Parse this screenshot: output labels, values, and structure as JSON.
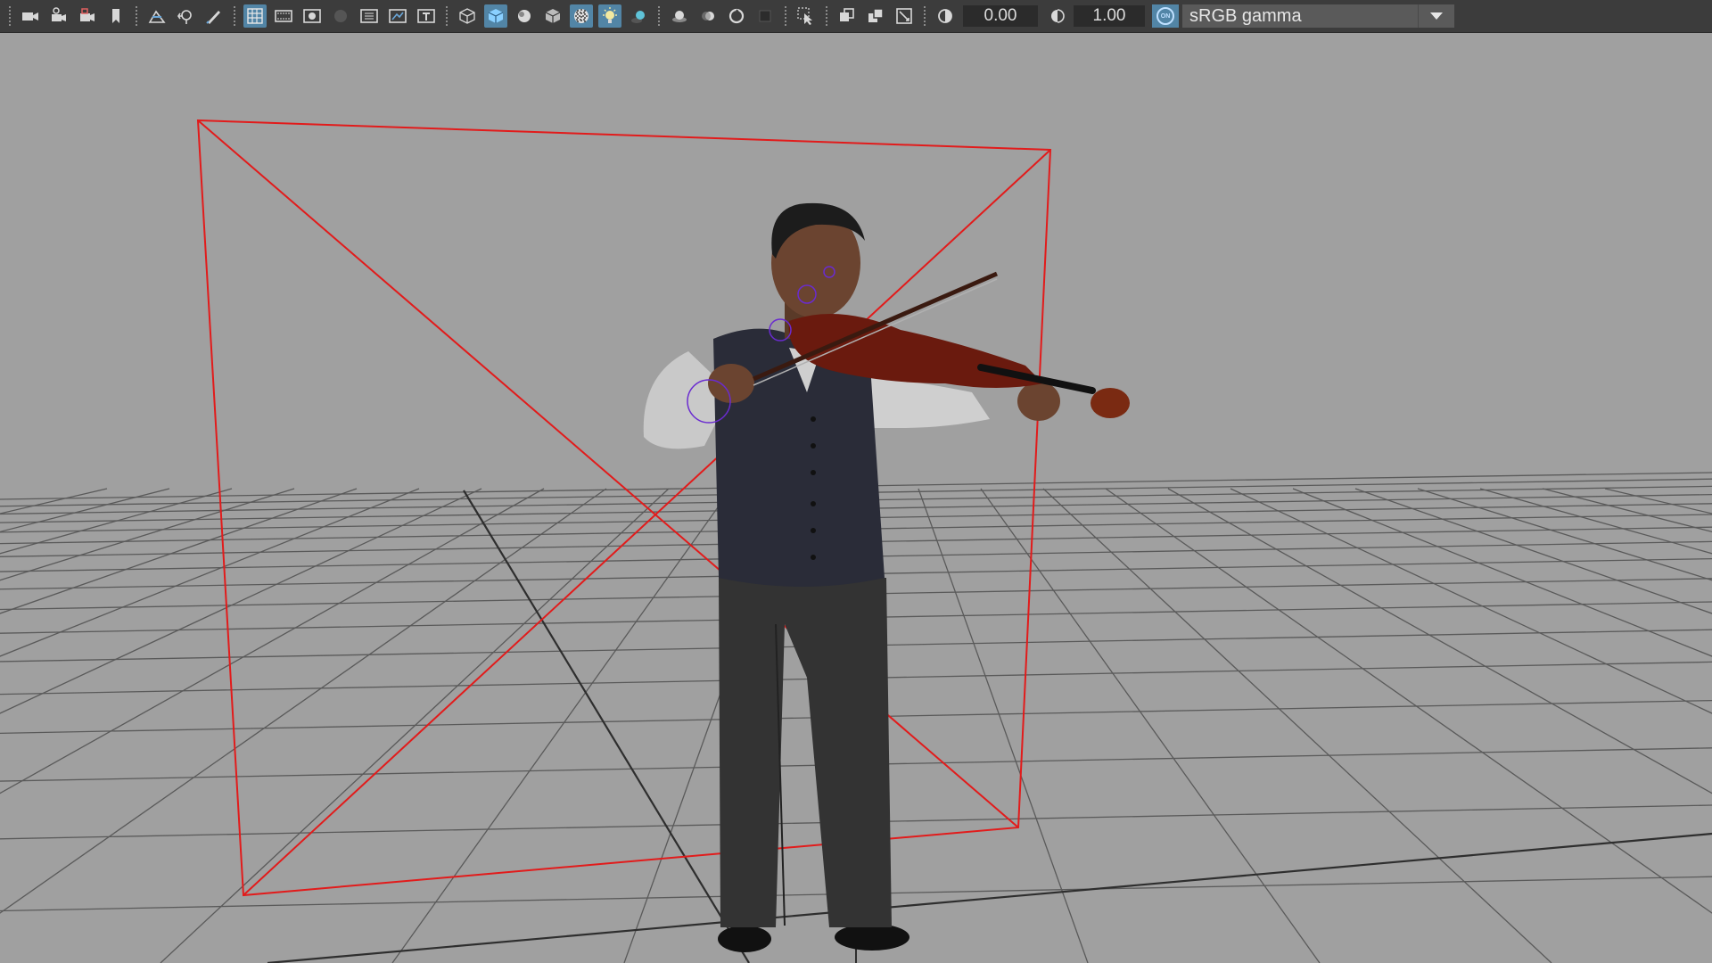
{
  "toolbar": {
    "exposure_value": "0.00",
    "gamma_value": "1.00",
    "color_management_label": "ON",
    "color_space": "sRGB gamma",
    "icons": [
      "camera-icon",
      "camera-attributes-icon",
      "camera-lock-icon",
      "bookmark-icon",
      "image-plane-icon",
      "2d-pan-zoom-icon",
      "grease-pencil-icon",
      "grid-icon",
      "film-gate-icon",
      "resolution-gate-icon",
      "gate-mask-icon",
      "field-chart-icon",
      "safe-action-icon",
      "safe-title-icon",
      "wireframe-icon",
      "smooth-shade-icon",
      "default-material-icon",
      "wireframe-on-shaded-icon",
      "textured-icon",
      "use-lights-icon",
      "shadows-icon",
      "screen-space-ao-icon",
      "motion-blur-icon",
      "anti-aliasing-icon",
      "depth-of-field-icon",
      "isolate-select-icon",
      "xray-icon",
      "xray-joints-icon",
      "backface-cull-icon",
      "exposure-icon",
      "gamma-icon"
    ]
  },
  "colors": {
    "toolbar_bg": "#3c3c3c",
    "viewport_bg": "#a0a0a0",
    "active_button": "#5285a6",
    "grid_line": "#5a5a5a",
    "grid_axis": "#2e2e2e",
    "camera_frustum": "#e21b1b"
  }
}
